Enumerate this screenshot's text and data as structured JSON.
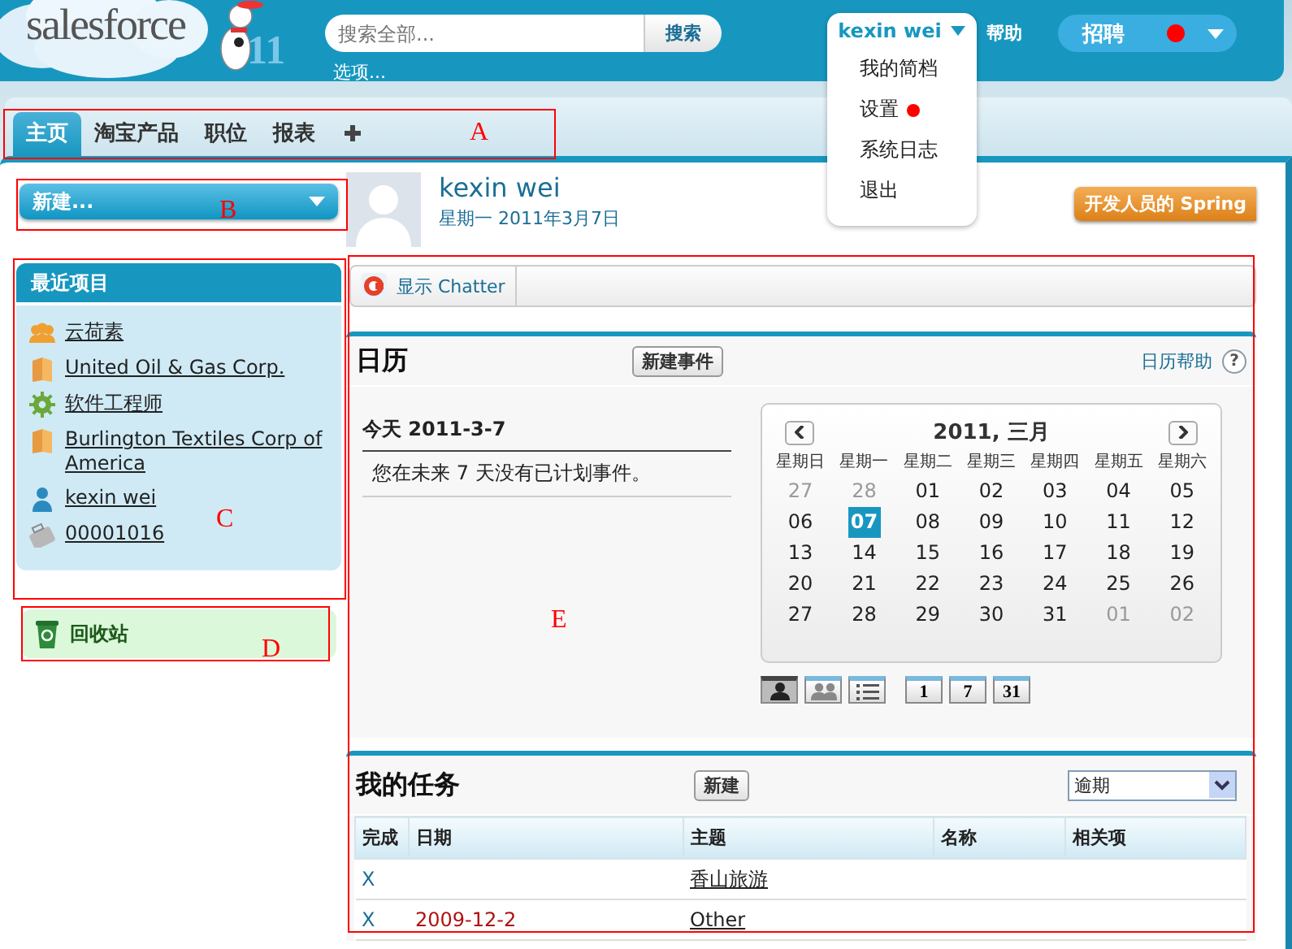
{
  "header": {
    "logo": {
      "wordmark": "salesforce",
      "release": "11"
    },
    "search": {
      "placeholder": "搜索全部...",
      "button": "搜索",
      "options_link": "选项..."
    },
    "user_menu": {
      "name": "kexin wei",
      "expanded": true,
      "items": [
        {
          "label": "我的简档",
          "marked": false
        },
        {
          "label": "设置",
          "marked": true
        },
        {
          "label": "系统日志",
          "marked": false
        },
        {
          "label": "退出",
          "marked": false
        }
      ]
    },
    "help_link": "帮助",
    "app_menu": {
      "label": "招聘",
      "marked": true
    }
  },
  "tab_bar": {
    "annotation": "A",
    "tabs": [
      {
        "label": "主页",
        "selected": true
      },
      {
        "label": "淘宝产品",
        "selected": false
      },
      {
        "label": "职位",
        "selected": false
      },
      {
        "label": "报表",
        "selected": false
      }
    ]
  },
  "sidebar": {
    "new_menu": {
      "label": "新建...",
      "annotation": "B"
    },
    "recent_items": {
      "title": "最近项目",
      "annotation": "C",
      "items": [
        {
          "label": "云荷素",
          "kind": "group"
        },
        {
          "label": "United Oil & Gas Corp.",
          "kind": "account"
        },
        {
          "label": "软件工程师",
          "kind": "position"
        },
        {
          "label": "Burlington Textiles Corp of America",
          "kind": "account"
        },
        {
          "label": "kexin wei",
          "kind": "user"
        },
        {
          "label": "00001016",
          "kind": "case"
        }
      ]
    },
    "recycle_bin": {
      "label": "回收站",
      "annotation": "D"
    }
  },
  "main": {
    "profile": {
      "name": "kexin wei",
      "date": "星期一 2011年3月7日",
      "promo_button": "开发人员的 Spring"
    },
    "annotation": "E",
    "chatter_toggle": "显示 Chatter",
    "calendar": {
      "title": "日历",
      "new_event_button": "新建事件",
      "help_link": "日历帮助",
      "help_icon": "?",
      "today_label": "今天 2011-3-7",
      "message": "您在未来 7 天没有已计划事件。",
      "month_title": "2011, 三月",
      "weekdays": [
        "星期日",
        "星期一",
        "星期二",
        "星期三",
        "星期四",
        "星期五",
        "星期六"
      ],
      "weeks": [
        [
          {
            "d": "27",
            "outside": true,
            "selected": false
          },
          {
            "d": "28",
            "outside": true,
            "selected": false
          },
          {
            "d": "01",
            "outside": false,
            "selected": false
          },
          {
            "d": "02",
            "outside": false,
            "selected": false
          },
          {
            "d": "03",
            "outside": false,
            "selected": false
          },
          {
            "d": "04",
            "outside": false,
            "selected": false
          },
          {
            "d": "05",
            "outside": false,
            "selected": false
          }
        ],
        [
          {
            "d": "06",
            "outside": false,
            "selected": false
          },
          {
            "d": "07",
            "outside": false,
            "selected": true
          },
          {
            "d": "08",
            "outside": false,
            "selected": false
          },
          {
            "d": "09",
            "outside": false,
            "selected": false
          },
          {
            "d": "10",
            "outside": false,
            "selected": false
          },
          {
            "d": "11",
            "outside": false,
            "selected": false
          },
          {
            "d": "12",
            "outside": false,
            "selected": false
          }
        ],
        [
          {
            "d": "13",
            "outside": false,
            "selected": false
          },
          {
            "d": "14",
            "outside": false,
            "selected": false
          },
          {
            "d": "15",
            "outside": false,
            "selected": false
          },
          {
            "d": "16",
            "outside": false,
            "selected": false
          },
          {
            "d": "17",
            "outside": false,
            "selected": false
          },
          {
            "d": "18",
            "outside": false,
            "selected": false
          },
          {
            "d": "19",
            "outside": false,
            "selected": false
          }
        ],
        [
          {
            "d": "20",
            "outside": false,
            "selected": false
          },
          {
            "d": "21",
            "outside": false,
            "selected": false
          },
          {
            "d": "22",
            "outside": false,
            "selected": false
          },
          {
            "d": "23",
            "outside": false,
            "selected": false
          },
          {
            "d": "24",
            "outside": false,
            "selected": false
          },
          {
            "d": "25",
            "outside": false,
            "selected": false
          },
          {
            "d": "26",
            "outside": false,
            "selected": false
          }
        ],
        [
          {
            "d": "27",
            "outside": false,
            "selected": false
          },
          {
            "d": "28",
            "outside": false,
            "selected": false
          },
          {
            "d": "29",
            "outside": false,
            "selected": false
          },
          {
            "d": "30",
            "outside": false,
            "selected": false
          },
          {
            "d": "31",
            "outside": false,
            "selected": false
          },
          {
            "d": "01",
            "outside": true,
            "selected": false
          },
          {
            "d": "02",
            "outside": true,
            "selected": false
          }
        ]
      ],
      "views": [
        {
          "kind": "single",
          "selected": true
        },
        {
          "kind": "multi",
          "selected": false
        },
        {
          "kind": "list",
          "selected": false
        },
        {
          "kind": "number",
          "label": "1",
          "selected": false
        },
        {
          "kind": "number",
          "label": "7",
          "selected": false
        },
        {
          "kind": "number",
          "label": "31",
          "selected": false
        }
      ]
    },
    "tasks": {
      "title": "我的任务",
      "new_button": "新建",
      "filter": "逾期",
      "columns": [
        "完成",
        "日期",
        "主题",
        "名称",
        "相关项"
      ],
      "rows": [
        {
          "complete": "X",
          "subject": "香山旅游"
        },
        {
          "complete": "X",
          "date": "2009-12-2",
          "subject": "Other"
        }
      ]
    }
  }
}
